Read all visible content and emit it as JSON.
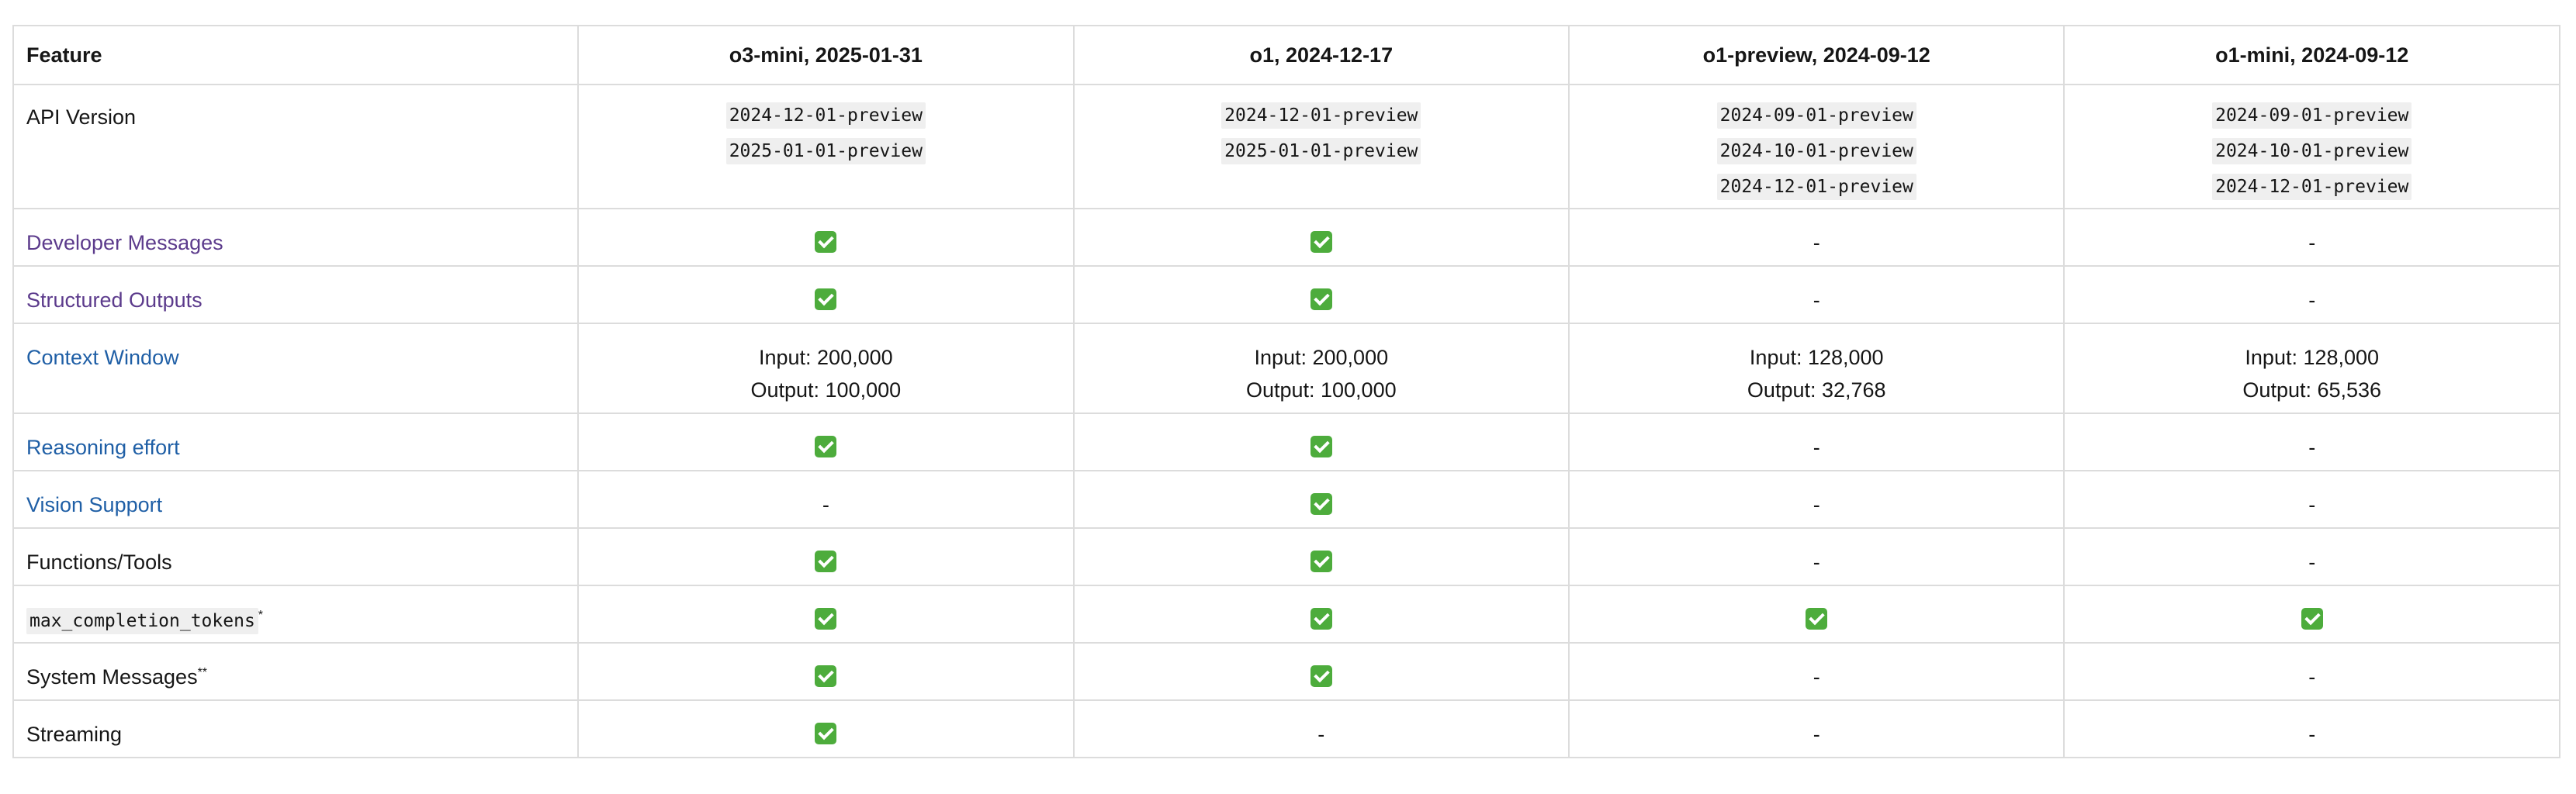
{
  "headers": [
    "Feature",
    "o3-mini, 2025-01-31",
    "o1, 2024-12-17",
    "o1-preview, 2024-09-12",
    "o1-mini, 2024-09-12"
  ],
  "colors": {
    "link_purple": "#5c3b8c",
    "link_blue": "#1f5fa6",
    "check_green": "#4dac3c",
    "border": "#dcdcdc"
  },
  "rows": {
    "api": {
      "label": "API Version",
      "cells": [
        [
          "2024-12-01-preview",
          "2025-01-01-preview"
        ],
        [
          "2024-12-01-preview",
          "2025-01-01-preview"
        ],
        [
          "2024-09-01-preview",
          "2024-10-01-preview",
          "2024-12-01-preview"
        ],
        [
          "2024-09-01-preview",
          "2024-10-01-preview",
          "2024-12-01-preview"
        ]
      ]
    },
    "developer": {
      "label": "Developer Messages",
      "cells": [
        "✅",
        "✅",
        "-",
        "-"
      ]
    },
    "structured": {
      "label": "Structured Outputs",
      "cells": [
        "✅",
        "✅",
        "-",
        "-"
      ]
    },
    "context": {
      "label": "Context Window",
      "cells": [
        [
          "Input: 200,000",
          "Output: 100,000"
        ],
        [
          "Input: 200,000",
          "Output: 100,000"
        ],
        [
          "Input: 128,000",
          "Output: 32,768"
        ],
        [
          "Input: 128,000",
          "Output: 65,536"
        ]
      ]
    },
    "reasoning": {
      "label": "Reasoning effort",
      "cells": [
        "✅",
        "✅",
        "-",
        "-"
      ]
    },
    "vision": {
      "label": "Vision Support",
      "cells": [
        "-",
        "✅",
        "-",
        "-"
      ]
    },
    "functions": {
      "label": "Functions/Tools",
      "cells": [
        "✅",
        "✅",
        "-",
        "-"
      ]
    },
    "max_tokens": {
      "label": "max_completion_tokens",
      "sup": "*",
      "cells": [
        "✅",
        "✅",
        "✅",
        "✅"
      ]
    },
    "system": {
      "label": "System Messages",
      "sup": "**",
      "cells": [
        "✅",
        "✅",
        "-",
        "-"
      ]
    },
    "streaming": {
      "label": "Streaming",
      "cells": [
        "✅",
        "-",
        "-",
        "-"
      ]
    }
  }
}
